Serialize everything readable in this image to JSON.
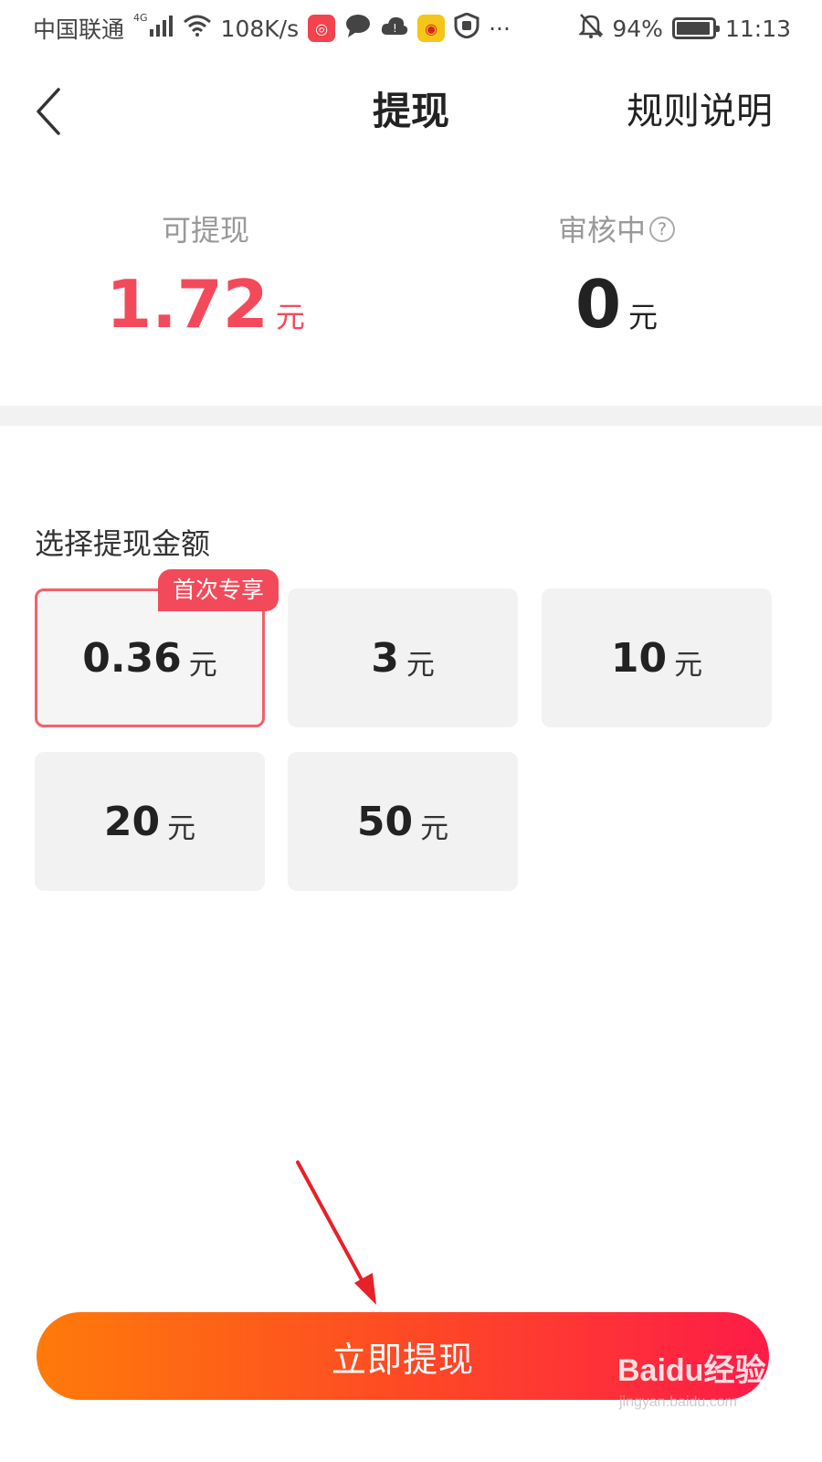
{
  "status_bar": {
    "carrier": "中国联通",
    "network_type": "4G",
    "speed": "108K/s",
    "more": "···",
    "battery": "94%",
    "battery_level": 0.94,
    "time": "11:13"
  },
  "nav": {
    "title": "提现",
    "rules_label": "规则说明"
  },
  "balance": {
    "available_label": "可提现",
    "available_amount": "1.72",
    "available_unit": "元",
    "reviewing_label": "审核中",
    "reviewing_amount": "0",
    "reviewing_unit": "元",
    "help_symbol": "?"
  },
  "amount_section": {
    "title": "选择提现金额",
    "options": [
      {
        "value": "0.36",
        "unit": "元",
        "badge": "首次专享",
        "selected": true
      },
      {
        "value": "3",
        "unit": "元"
      },
      {
        "value": "10",
        "unit": "元"
      },
      {
        "value": "20",
        "unit": "元"
      },
      {
        "value": "50",
        "unit": "元"
      }
    ]
  },
  "submit": {
    "label": "立即提现"
  },
  "watermark": {
    "logo_text": "Baidu经验",
    "url": "jingyan.baidu.com"
  },
  "colors": {
    "accent_red": "#f34a5b",
    "button_gradient_start": "#ff7a0a",
    "button_gradient_end": "#fd1c48",
    "annotation_arrow": "#e8202a"
  }
}
